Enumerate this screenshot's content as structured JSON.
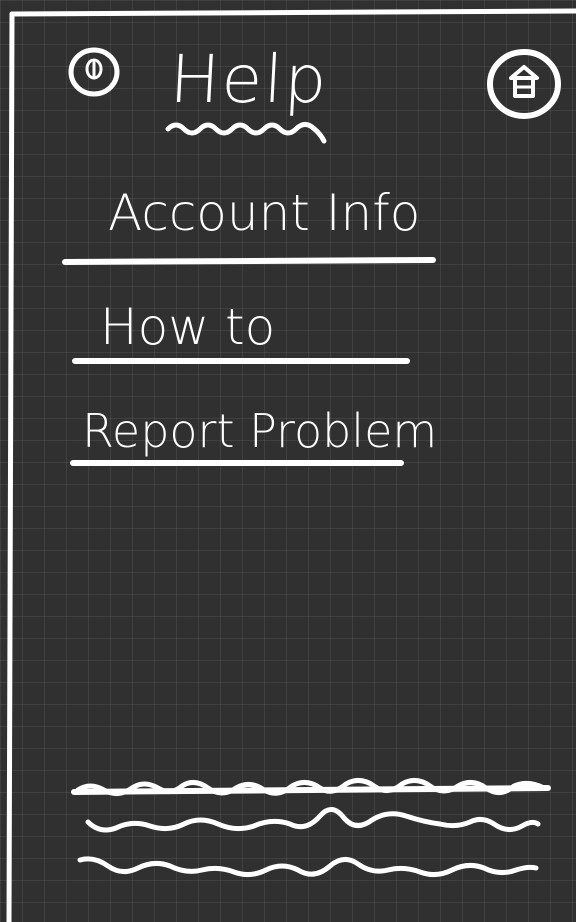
{
  "header": {
    "title": "Help",
    "info_icon": "info-circle-icon",
    "home_icon": "home-icon"
  },
  "menu": {
    "items": [
      {
        "id": "account",
        "label": "Account Info"
      },
      {
        "id": "howto",
        "label": "How to"
      },
      {
        "id": "report",
        "label": "Report Problem"
      }
    ]
  },
  "footer": {
    "placeholder_lines": 3
  },
  "colors": {
    "background": "#303030",
    "grid": "#444444",
    "ink": "#ffffff"
  }
}
